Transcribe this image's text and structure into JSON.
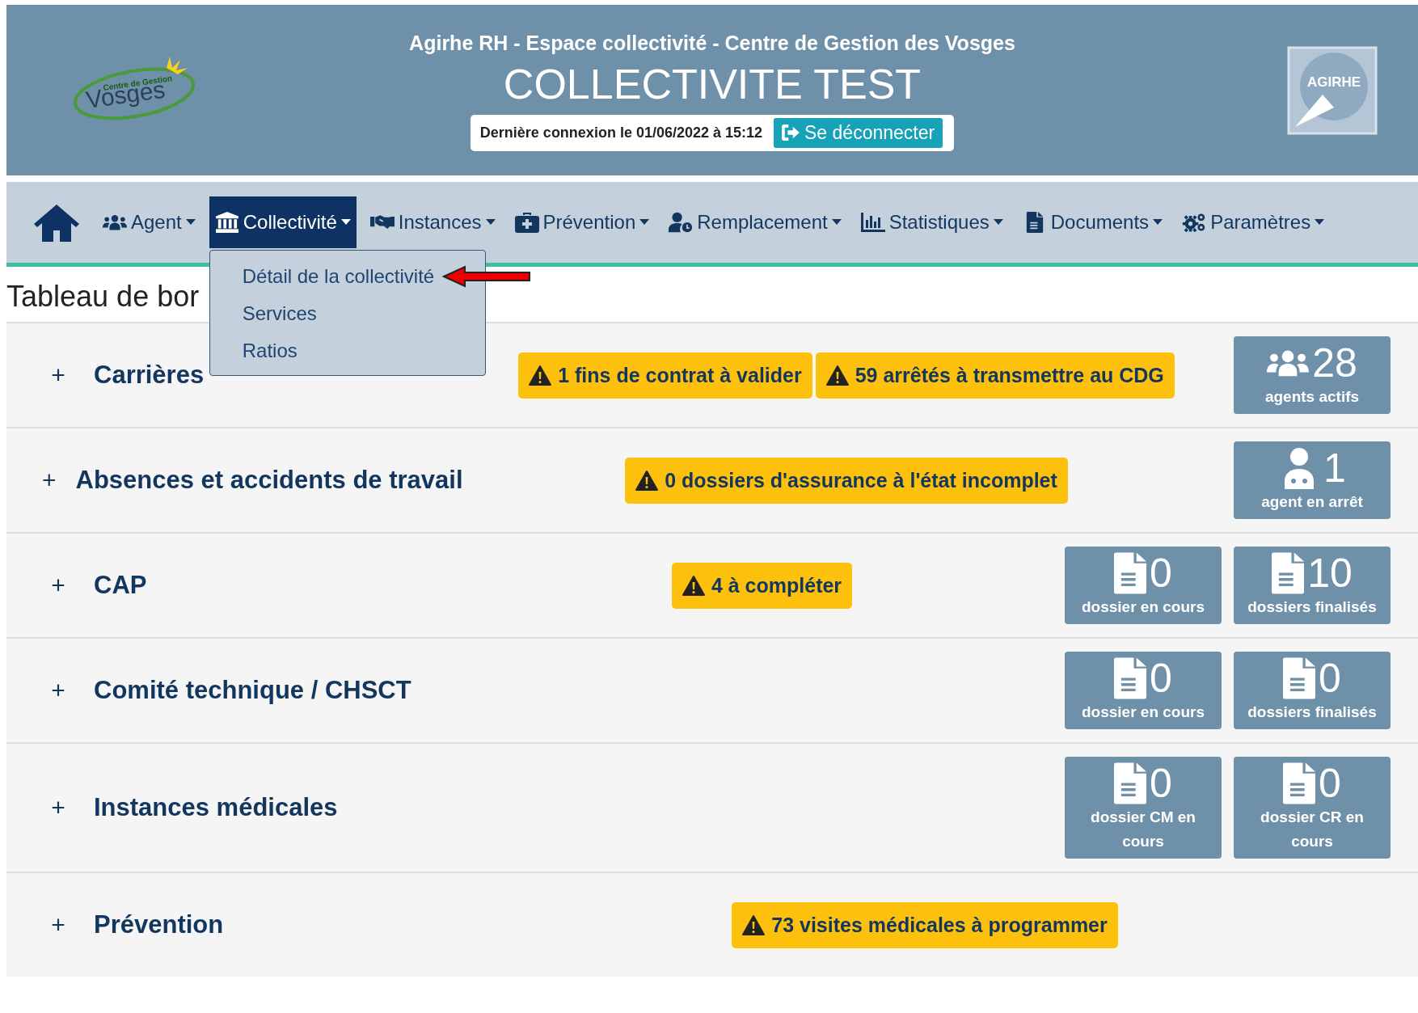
{
  "header": {
    "logo_text": [
      "Centre de Gestion",
      "Vosges"
    ],
    "subtitle": "Agirhe RH - Espace collectivité - Centre de Gestion des Vosges",
    "title": "COLLECTIVITE TEST",
    "last_login": "Dernière connexion le 01/06/2022 à 15:12",
    "logout": "Se déconnecter",
    "brand_logo_text": "AGIRHE"
  },
  "nav": {
    "items": [
      {
        "label": "Agent",
        "selected": false
      },
      {
        "label": "Collectivité",
        "selected": true,
        "menu": [
          {
            "label": "Détail de la collectivité",
            "pointed": true
          },
          {
            "label": "Services",
            "pointed": false
          },
          {
            "label": "Ratios",
            "pointed": false
          }
        ]
      },
      {
        "label": "Instances",
        "selected": false
      },
      {
        "label": "Prévention",
        "selected": false
      },
      {
        "label": "Remplacement",
        "selected": false
      },
      {
        "label": "Statistiques",
        "selected": false
      },
      {
        "label": "Documents",
        "selected": false
      },
      {
        "label": "Paramètres",
        "selected": false
      }
    ]
  },
  "page_title": "Tableau de bor",
  "sections": [
    {
      "toggle": "+",
      "title": "Carrières",
      "alerts": [
        "1 fins de contrat à valider",
        "59 arrêtés à transmettre au CDG"
      ],
      "tiles": [
        {
          "value": "28",
          "label": "agents actifs"
        }
      ]
    },
    {
      "toggle": "+",
      "title": "Absences et accidents de travail",
      "alerts": [
        "0 dossiers d'assurance à l'état incomplet"
      ],
      "tiles": [
        {
          "value": "1",
          "label": "agent en arrêt"
        }
      ]
    },
    {
      "toggle": "+",
      "title": "CAP",
      "alerts": [
        "4 à compléter"
      ],
      "tiles": [
        {
          "value": "0",
          "label": "dossier en cours"
        },
        {
          "value": "10",
          "label": "dossiers finalisés"
        }
      ]
    },
    {
      "toggle": "+",
      "title": "Comité technique / CHSCT",
      "tiles": [
        {
          "value": "0",
          "label": "dossier en cours"
        },
        {
          "value": "0",
          "label": "dossiers finalisés"
        }
      ]
    },
    {
      "toggle": "+",
      "title": "Instances médicales",
      "tiles": [
        {
          "value": "0",
          "label": "dossier CM en cours"
        },
        {
          "value": "0",
          "label": "dossier CR en cours"
        }
      ]
    },
    {
      "toggle": "+",
      "title": "Prévention",
      "alerts": [
        "73 visites médicales à programmer"
      ]
    }
  ]
}
